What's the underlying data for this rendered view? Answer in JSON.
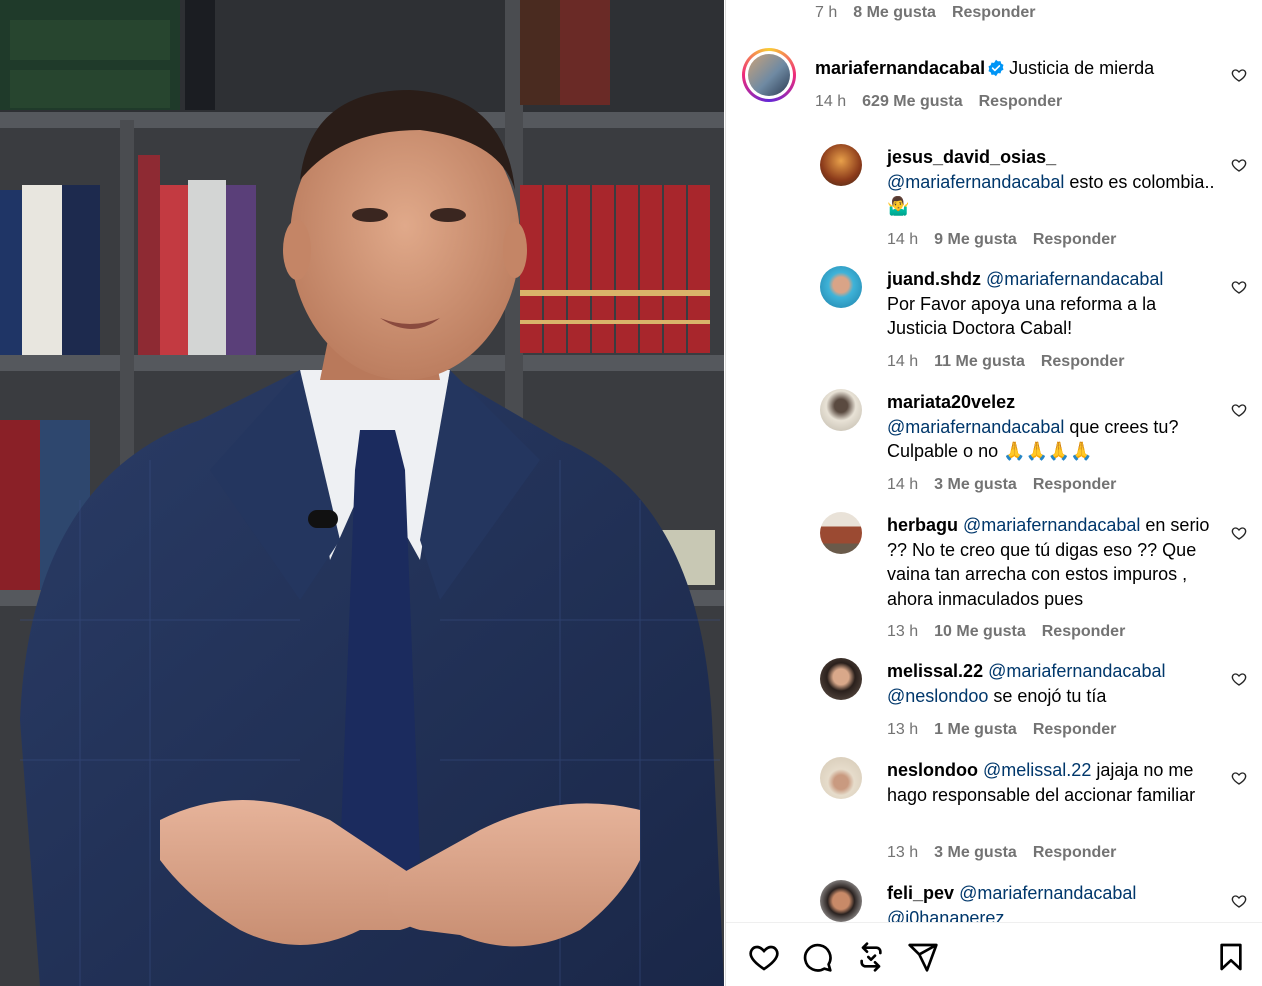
{
  "top_meta": {
    "time": "7 h",
    "likes": "8 Me gusta",
    "reply": "Responder"
  },
  "main_comment": {
    "user": "mariafernandacabal",
    "text": "Justicia de mierda",
    "time": "14 h",
    "likes": "629 Me gusta",
    "reply": "Responder"
  },
  "replies": [
    {
      "user": "jesus_david_osias_",
      "mention": "@mariafernandacabal",
      "text": " esto es colombia.. 🤷‍♂️",
      "time": "14 h",
      "likes": "9 Me gusta",
      "reply": "Responder"
    },
    {
      "user": "juand.shdz",
      "mention": "@mariafernandacabal",
      "text": "Por Favor apoya una reforma a la Justicia Doctora Cabal!",
      "time": "14 h",
      "likes": "11 Me gusta",
      "reply": "Responder"
    },
    {
      "user": "mariata20velez",
      "mention": "@mariafernandacabal",
      "text": " que crees tu? Culpable o no 🙏🙏🙏🙏",
      "time": "14 h",
      "likes": "3 Me gusta",
      "reply": "Responder"
    },
    {
      "user": "herbagu",
      "mention": "@mariafernandacabal",
      "text": " en serio ?? No te creo que tú digas eso ?? Que vaina tan arrecha con estos impuros , ahora inmaculados pues",
      "time": "13 h",
      "likes": "10 Me gusta",
      "reply": "Responder"
    },
    {
      "user": "melissal.22",
      "mention": "@mariafernandacabal",
      "mention2": "@neslondoo",
      "text": " se enojó tu tía",
      "time": "13 h",
      "likes": "1 Me gusta",
      "reply": "Responder"
    },
    {
      "user": "neslondoo",
      "mention": "@melissal.22",
      "text": " jajaja no me hago responsable del accionar familiar",
      "time": "13 h",
      "likes": "3 Me gusta",
      "reply": "Responder"
    },
    {
      "user": "feli_pev",
      "mention": "@mariafernandacabal",
      "mention2": "@j0hanaperez",
      "text": ""
    }
  ],
  "actions": {
    "like": "heart-icon",
    "comment": "comment-icon",
    "repost": "repost-icon",
    "share": "share-icon",
    "save": "bookmark-icon"
  },
  "colors": {
    "mention": "#00376b",
    "meta": "#737373",
    "verified": "#0095f6"
  }
}
